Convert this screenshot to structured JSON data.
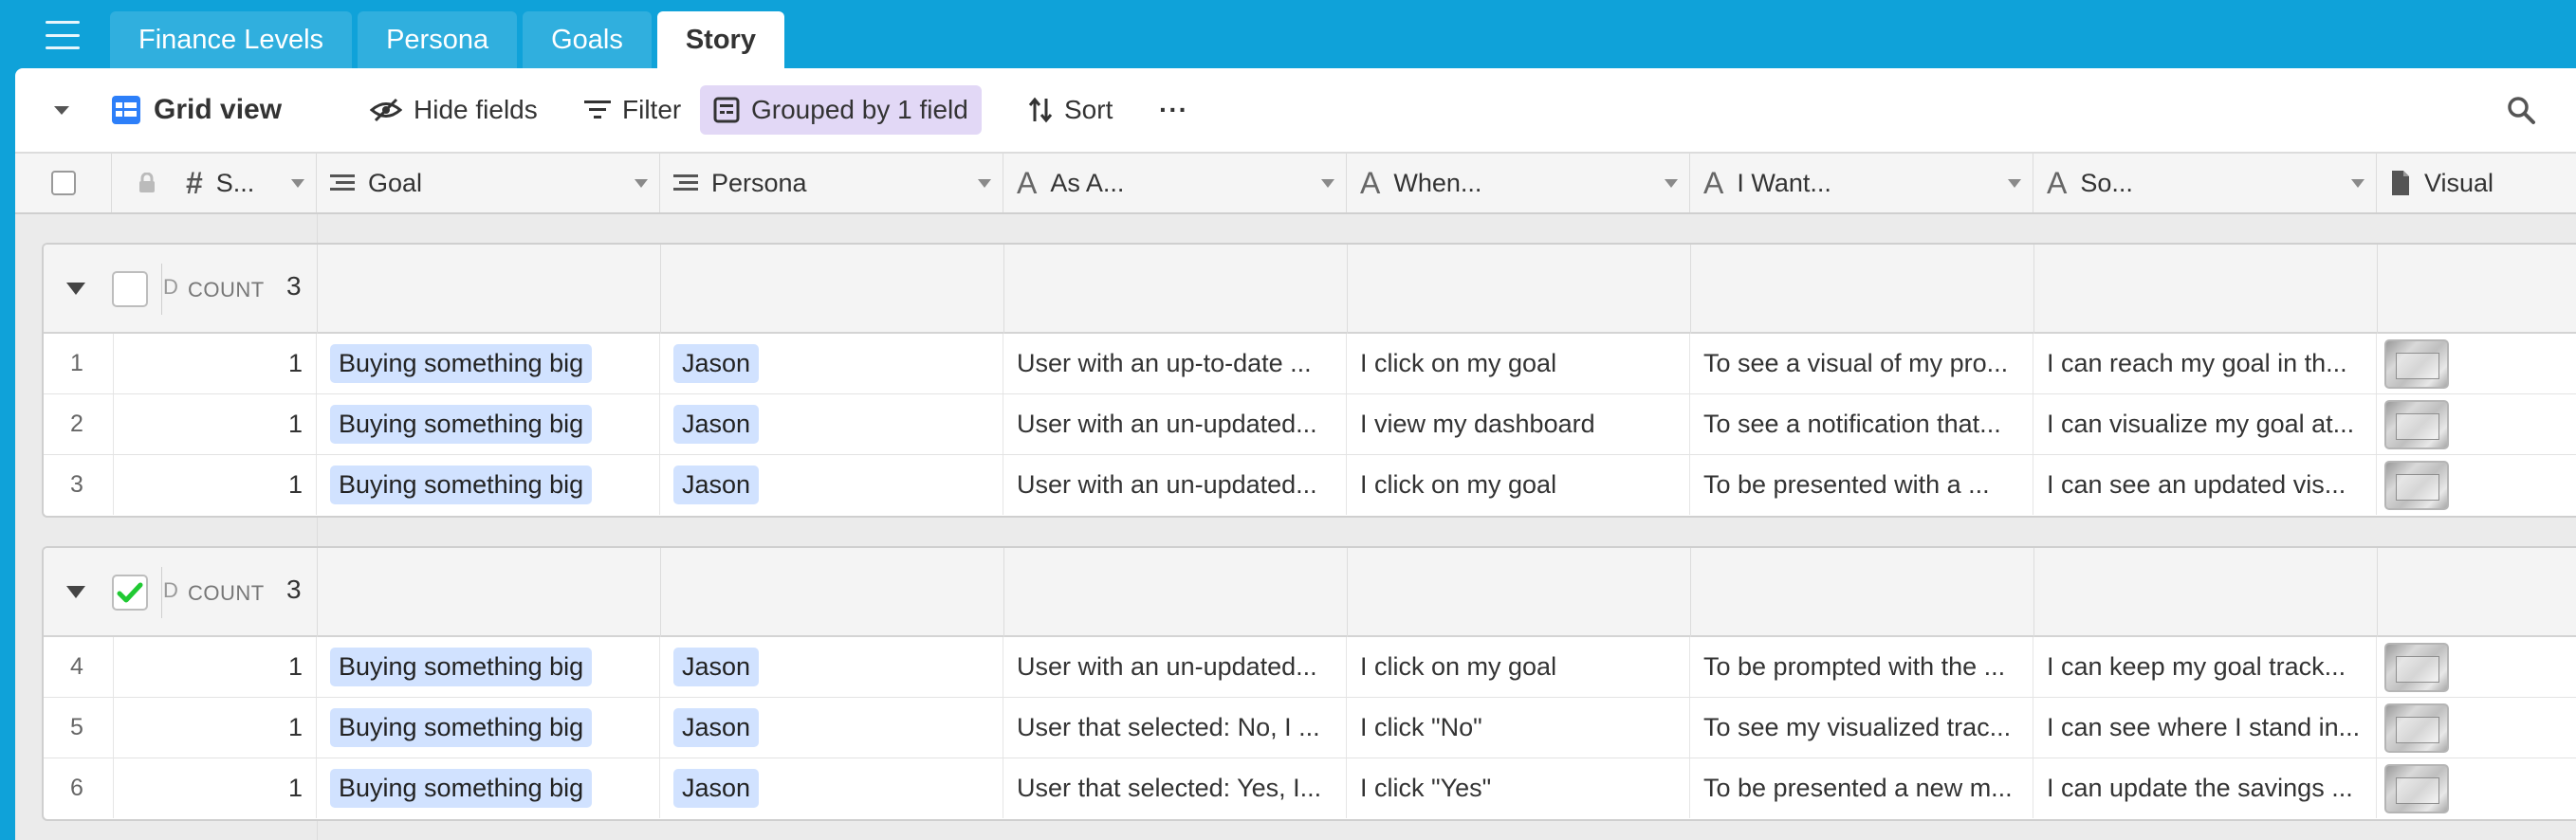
{
  "tabs": [
    {
      "label": "Finance Levels",
      "active": false
    },
    {
      "label": "Persona",
      "active": false
    },
    {
      "label": "Goals",
      "active": false
    },
    {
      "label": "Story",
      "active": true
    }
  ],
  "toolbar": {
    "view_name": "Grid view",
    "hide_fields": "Hide fields",
    "filter": "Filter",
    "grouped": "Grouped by 1 field",
    "sort": "Sort",
    "more": "···"
  },
  "columns": [
    {
      "label": "S...",
      "icon": "number-icon"
    },
    {
      "label": "Goal",
      "icon": "link-icon"
    },
    {
      "label": "Persona",
      "icon": "link-icon"
    },
    {
      "label": "As A...",
      "icon": "text-icon"
    },
    {
      "label": "When...",
      "icon": "text-icon"
    },
    {
      "label": "I Want...",
      "icon": "text-icon"
    },
    {
      "label": "So...",
      "icon": "text-icon"
    },
    {
      "label": "Visual",
      "icon": "attachment-icon"
    }
  ],
  "groups": [
    {
      "checked": false,
      "trunc_label": "D",
      "count_label": "COUNT",
      "count": "3",
      "rows": [
        {
          "num": "1",
          "s": "1",
          "goal": "Buying something big",
          "persona": "Jason",
          "as_a": "User with an up-to-date ...",
          "when": "I click on my goal",
          "i_want": "To see a visual of my pro...",
          "so": "I can reach my goal in th..."
        },
        {
          "num": "2",
          "s": "1",
          "goal": "Buying something big",
          "persona": "Jason",
          "as_a": "User with an un-updated...",
          "when": "I view my dashboard",
          "i_want": "To see a notification that...",
          "so": "I can visualize my goal at..."
        },
        {
          "num": "3",
          "s": "1",
          "goal": "Buying something big",
          "persona": "Jason",
          "as_a": "User with an un-updated...",
          "when": "I click on my goal",
          "i_want": "To be presented with a ...",
          "so": "I can see an updated vis..."
        }
      ]
    },
    {
      "checked": true,
      "trunc_label": "D",
      "count_label": "COUNT",
      "count": "3",
      "rows": [
        {
          "num": "4",
          "s": "1",
          "goal": "Buying something big",
          "persona": "Jason",
          "as_a": "User with an un-updated...",
          "when": "I click on my goal",
          "i_want": "To be prompted with the ...",
          "so": "I can keep my goal track..."
        },
        {
          "num": "5",
          "s": "1",
          "goal": "Buying something big",
          "persona": "Jason",
          "as_a": "User that selected: No, I ...",
          "when": "I click \"No\"",
          "i_want": "To see my visualized trac...",
          "so": "I can see where I stand in..."
        },
        {
          "num": "6",
          "s": "1",
          "goal": "Buying something big",
          "persona": "Jason",
          "as_a": "User that selected: Yes, I...",
          "when": "I click \"Yes\"",
          "i_want": "To be presented a new m...",
          "so": "I can update the savings ..."
        }
      ]
    }
  ],
  "colors": {
    "accent": "#0fa2d9",
    "grouped_bg": "#e2d8f6",
    "pill_bg": "#d1e2ff",
    "check_green": "#20c933"
  }
}
